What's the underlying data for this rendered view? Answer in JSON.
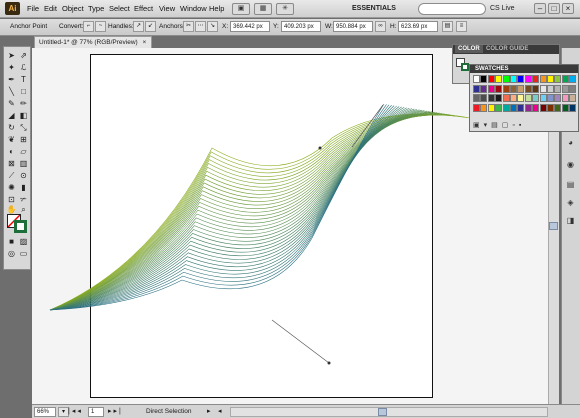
{
  "menubar": {
    "app_logo": "Ai",
    "items": [
      "File",
      "Edit",
      "Object",
      "Type",
      "Select",
      "Effect",
      "View",
      "Window",
      "Help"
    ],
    "workspace": "ESSENTIALS",
    "cslive": "CS Live"
  },
  "controlbar": {
    "tool_name": "Anchor Point",
    "convert": "Convert:",
    "handles": "Handles:",
    "anchors": "Anchors:",
    "x_label": "X:",
    "x_value": "369.442 px",
    "y_label": "Y:",
    "y_value": "409.203 px",
    "w_label": "W:",
    "w_value": "950.884 px",
    "h_label": "H:",
    "h_value": "623.69 px"
  },
  "document": {
    "tab_title": "Untitled-1* @ 77% (RGB/Preview)",
    "close_glyph": "×"
  },
  "panels": {
    "color_tab": "COLOR",
    "color_guide_tab": "COLOR GUIDE",
    "swatches_tab": "SWATCHES",
    "swatch_colors": [
      "#ffffff",
      "#000000",
      "#ff0000",
      "#ffff00",
      "#00ff00",
      "#00ffff",
      "#0000ff",
      "#ff00ff",
      "#e8261c",
      "#f7941d",
      "#fff200",
      "#8dc63f",
      "#00a651",
      "#00aeef",
      "#2e3192",
      "#662d91",
      "#ec008c",
      "#9e0b0f",
      "#a0410d",
      "#8c6239",
      "#c69c6d",
      "#754c24",
      "#603813",
      "#e6e6e6",
      "#cccccc",
      "#b3b3b3",
      "#999999",
      "#808080",
      "#666666",
      "#4d4d4d",
      "#333333",
      "#1a1a1a",
      "#f26c4f",
      "#f9ad81",
      "#fff799",
      "#c4df9b",
      "#7accc8",
      "#6dcff6",
      "#8493ca",
      "#a186be",
      "#f49ac1",
      "#c7b299",
      "#ed1c24",
      "#f7941d",
      "#fff200",
      "#39b54a",
      "#00a99d",
      "#0072bc",
      "#2e3192",
      "#92278f",
      "#ec008c",
      "#790000",
      "#7b2e00",
      "#406618",
      "#005e20",
      "#003663"
    ]
  },
  "status": {
    "zoom": "66%",
    "page": "1",
    "tool": "Direct Selection"
  }
}
